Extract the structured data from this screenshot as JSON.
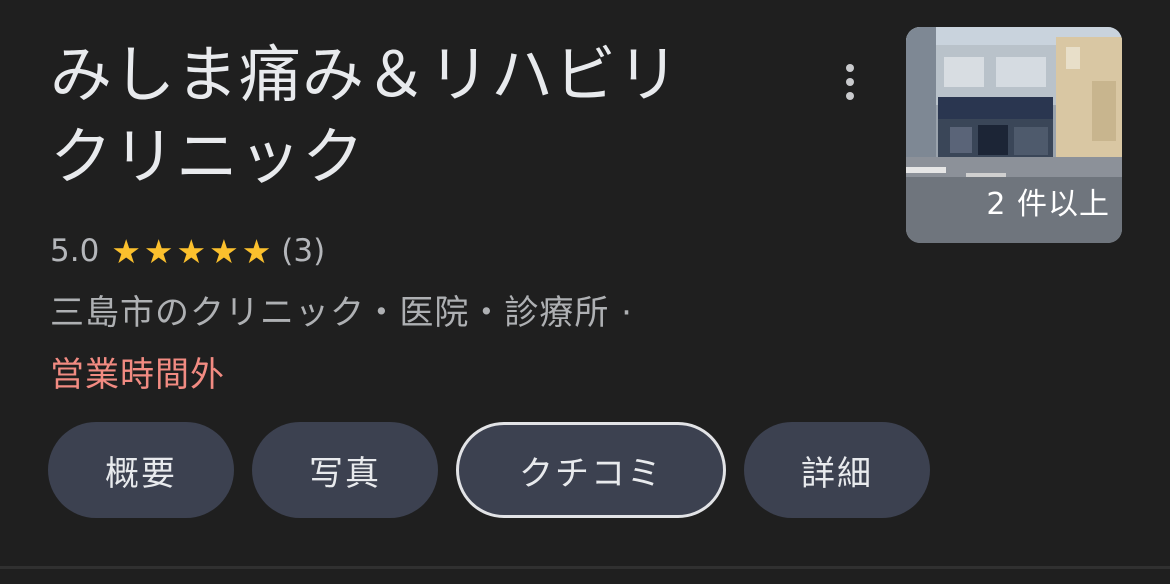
{
  "place": {
    "title_line1": "みしま痛み＆リハビリ",
    "title_line2": "クリニック",
    "rating": "5.0",
    "stars": 5,
    "review_count": "(3)",
    "category": "三島市のクリニック・医院・診療所 ·",
    "status": "営業時間外",
    "photo_count_label": "2 件以上"
  },
  "icons": {
    "more": "more-vert-icon",
    "star": "star-icon"
  },
  "tabs": [
    {
      "label": "概要"
    },
    {
      "label": "写真"
    },
    {
      "label": "クチコミ"
    },
    {
      "label": "詳細"
    }
  ],
  "colors": {
    "background": "#1f1f1f",
    "star": "#fbc02d",
    "status_closed": "#f28b82",
    "tab_background": "#3c4150"
  }
}
